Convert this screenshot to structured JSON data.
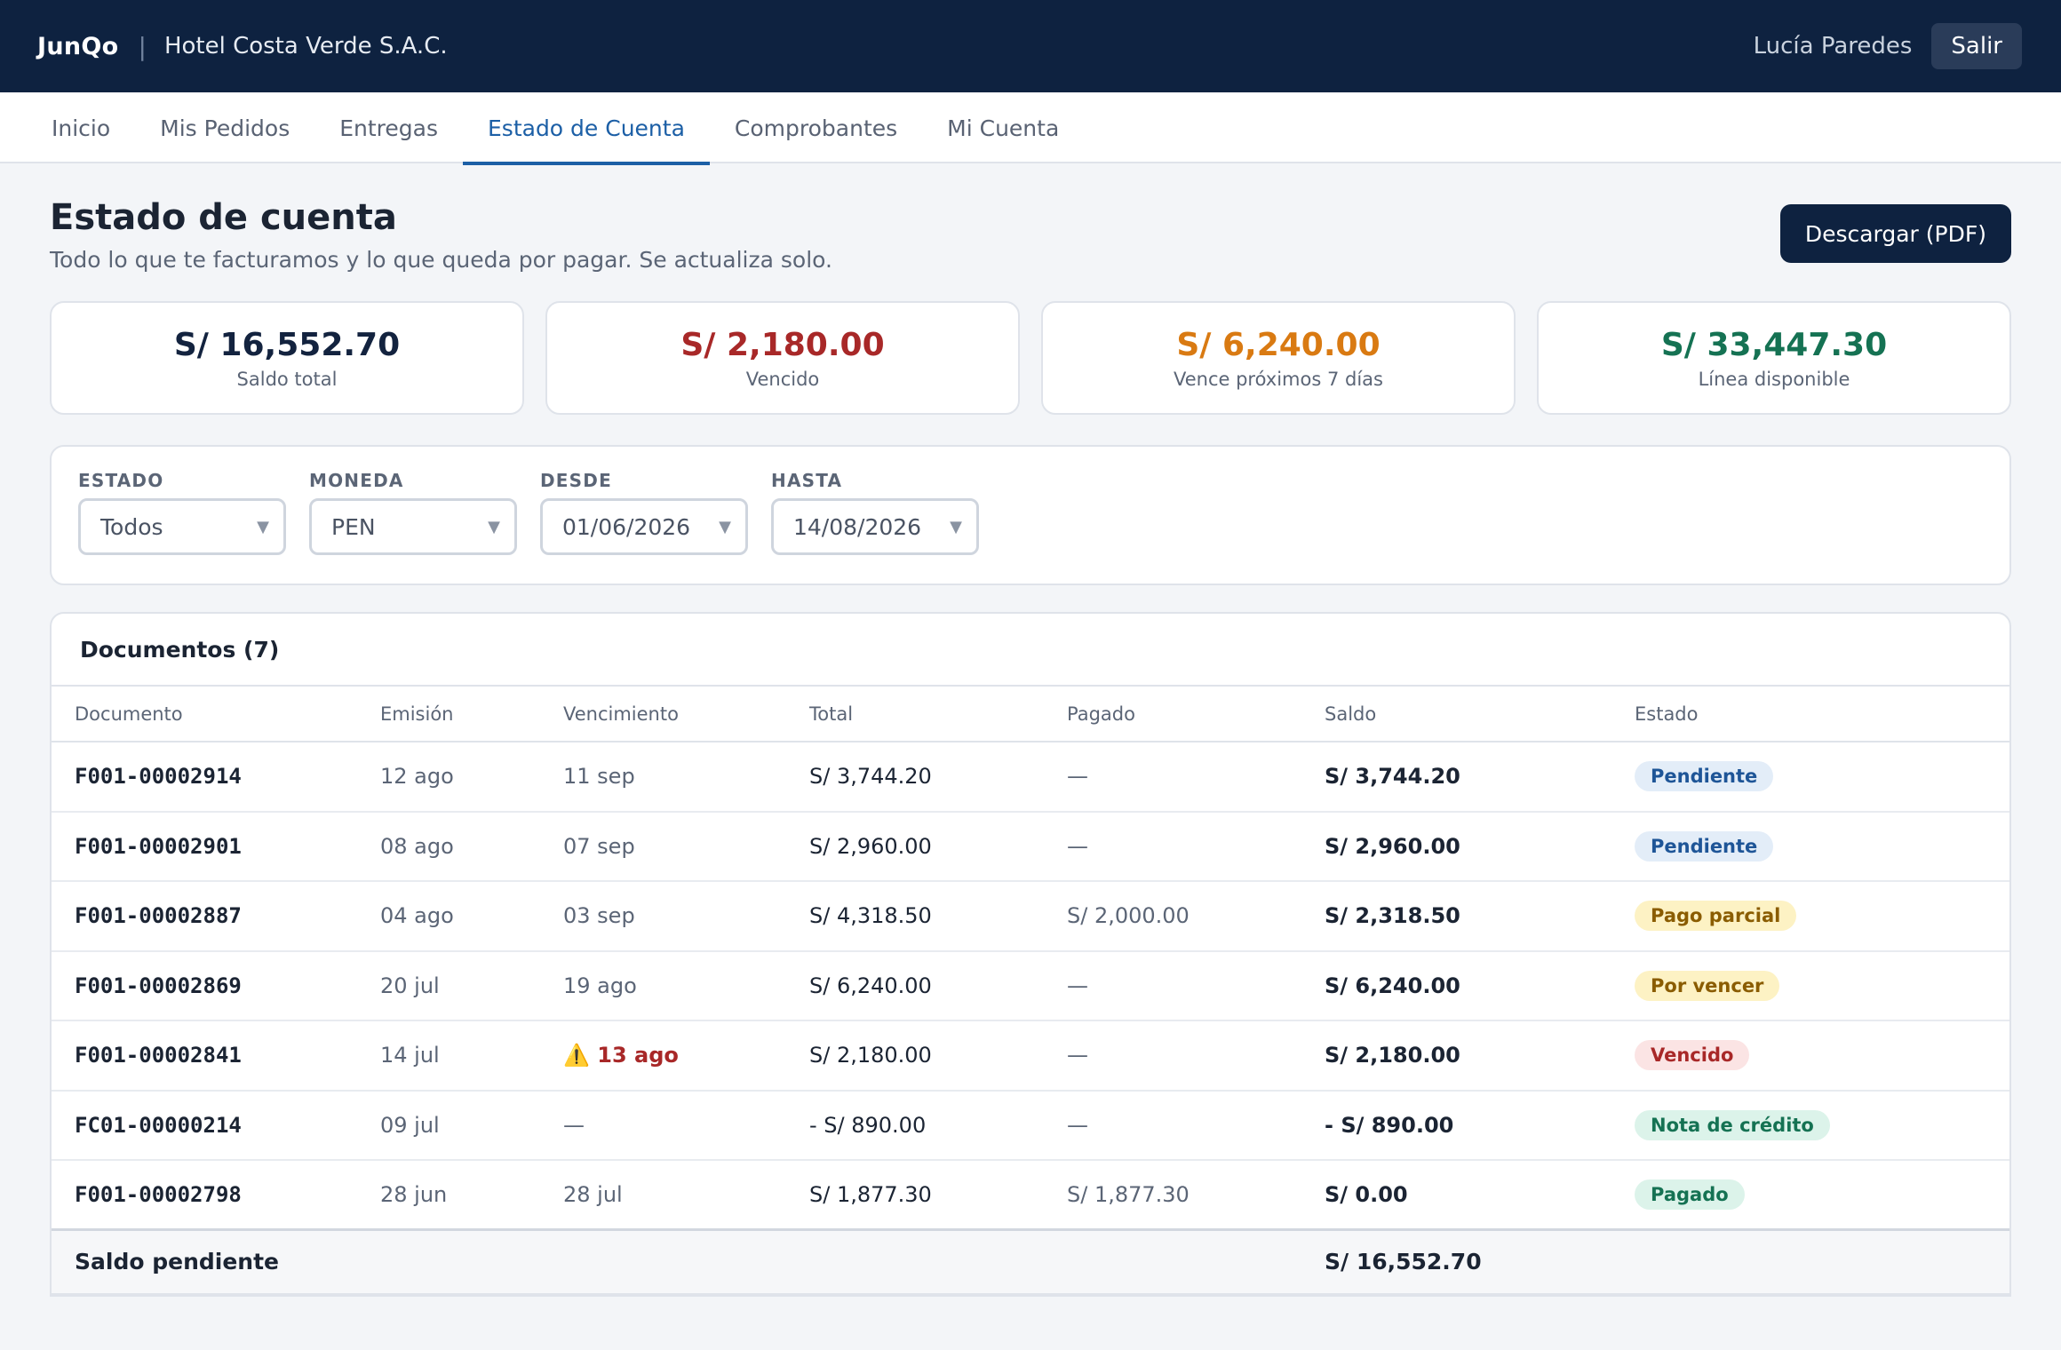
{
  "topbar": {
    "brand": "JunQo",
    "separator": "|",
    "company": "Hotel Costa Verde S.A.C.",
    "user": "Lucía Paredes",
    "logout_label": "Salir"
  },
  "nav": {
    "tabs": [
      {
        "label": "Inicio",
        "active": false
      },
      {
        "label": "Mis Pedidos",
        "active": false
      },
      {
        "label": "Entregas",
        "active": false
      },
      {
        "label": "Estado de Cuenta",
        "active": true
      },
      {
        "label": "Comprobantes",
        "active": false
      },
      {
        "label": "Mi Cuenta",
        "active": false
      }
    ]
  },
  "header": {
    "title": "Estado de cuenta",
    "subtitle": "Todo lo que te facturamos y lo que queda por pagar. Se actualiza solo.",
    "download_label": "Descargar (PDF)"
  },
  "summary": [
    {
      "amount": "S/ 16,552.70",
      "label": "Saldo total",
      "color": "#13233f"
    },
    {
      "amount": "S/ 2,180.00",
      "label": "Vencido",
      "color": "#a82828"
    },
    {
      "amount": "S/ 6,240.00",
      "label": "Vence próximos 7 días",
      "color": "#d97a12"
    },
    {
      "amount": "S/ 33,447.30",
      "label": "Línea disponible",
      "color": "#157253"
    }
  ],
  "filters": [
    {
      "label": "ESTADO",
      "value": "Todos"
    },
    {
      "label": "MONEDA",
      "value": "PEN"
    },
    {
      "label": "DESDE",
      "value": "01/06/2026"
    },
    {
      "label": "HASTA",
      "value": "14/08/2026"
    }
  ],
  "documents": {
    "title": "Documentos (7)",
    "columns": [
      "Documento",
      "Emisión",
      "Vencimiento",
      "Total",
      "Pagado",
      "Saldo",
      "Estado"
    ],
    "rows": [
      {
        "doc": "F001-00002914",
        "emision": "12 ago",
        "venc": "11 sep",
        "total": "S/ 3,744.20",
        "pagado": "—",
        "saldo": "S/ 3,744.20",
        "estado": "Pendiente",
        "badge": "b-pend",
        "overdue": false
      },
      {
        "doc": "F001-00002901",
        "emision": "08 ago",
        "venc": "07 sep",
        "total": "S/ 2,960.00",
        "pagado": "—",
        "saldo": "S/ 2,960.00",
        "estado": "Pendiente",
        "badge": "b-pend",
        "overdue": false
      },
      {
        "doc": "F001-00002887",
        "emision": "04 ago",
        "venc": "03 sep",
        "total": "S/ 4,318.50",
        "pagado": "S/ 2,000.00",
        "saldo": "S/ 2,318.50",
        "estado": "Pago parcial",
        "badge": "b-parcial",
        "overdue": false
      },
      {
        "doc": "F001-00002869",
        "emision": "20 jul",
        "venc": "19 ago",
        "total": "S/ 6,240.00",
        "pagado": "—",
        "saldo": "S/ 6,240.00",
        "estado": "Por vencer",
        "badge": "b-parcial",
        "overdue": false
      },
      {
        "doc": "F001-00002841",
        "emision": "14 jul",
        "venc": "⚠️ 13 ago",
        "total": "S/ 2,180.00",
        "pagado": "—",
        "saldo": "S/ 2,180.00",
        "estado": "Vencido",
        "badge": "b-vencido",
        "overdue": true
      },
      {
        "doc": "FC01-00000214",
        "emision": "09 jul",
        "venc": "—",
        "total": "- S/ 890.00",
        "pagado": "—",
        "saldo": "- S/ 890.00",
        "estado": "Nota de crédito",
        "badge": "b-nota",
        "overdue": false
      },
      {
        "doc": "F001-00002798",
        "emision": "28 jun",
        "venc": "28 jul",
        "total": "S/ 1,877.30",
        "pagado": "S/ 1,877.30",
        "saldo": "S/ 0.00",
        "estado": "Pagado",
        "badge": "b-pagado",
        "overdue": false
      }
    ],
    "footer": {
      "label": "Saldo pendiente",
      "amount": "S/ 16,552.70"
    }
  }
}
